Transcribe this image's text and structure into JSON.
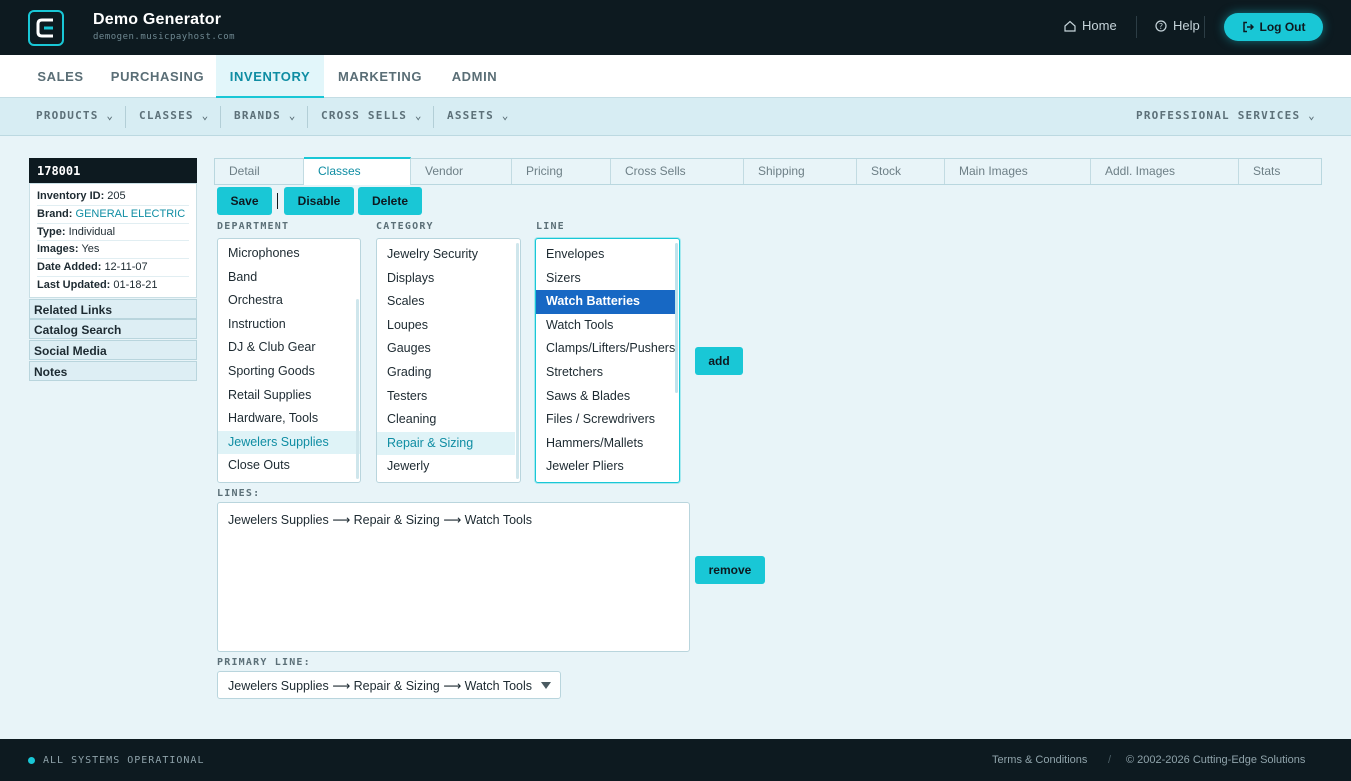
{
  "header": {
    "app_title": "Demo Generator",
    "app_subtitle": "demogen.musicpayhost.com",
    "home_label": "Home",
    "help_label": "Help",
    "logout_label": "Log Out"
  },
  "main_nav": [
    "SALES",
    "PURCHASING",
    "INVENTORY",
    "MARKETING",
    "ADMIN"
  ],
  "main_nav_active": "INVENTORY",
  "sub_nav": [
    "PRODUCTS",
    "CLASSES",
    "BRANDS",
    "CROSS SELLS",
    "ASSETS"
  ],
  "sub_nav_right": "PROFESSIONAL SERVICES",
  "product": {
    "sku": "178001",
    "inventory_id_label": "Inventory ID:",
    "inventory_id": "205",
    "brand_label": "Brand:",
    "brand": "GENERAL ELECTRIC",
    "type_label": "Type:",
    "type": "Individual",
    "images_label": "Images:",
    "images": "Yes",
    "date_added_label": "Date Added:",
    "date_added": "12-11-07",
    "last_updated_label": "Last Updated:",
    "last_updated": "01-18-21"
  },
  "side_links": [
    "Related Links",
    "Catalog Search",
    "Social Media",
    "Notes"
  ],
  "tabs": [
    "Detail",
    "Classes",
    "Vendor",
    "Pricing",
    "Cross Sells",
    "Shipping",
    "Stock",
    "Main Images",
    "Addl. Images",
    "Stats"
  ],
  "active_tab": "Classes",
  "actions": {
    "save": "Save",
    "disable": "Disable",
    "delete": "Delete",
    "add": "add",
    "remove": "remove"
  },
  "labels": {
    "department": "DEPARTMENT",
    "category": "CATEGORY",
    "line": "LINE",
    "lines": "LINES:",
    "primary_line": "PRIMARY LINE:"
  },
  "departments": [
    "Microphones",
    "Band",
    "Orchestra",
    "Instruction",
    "DJ & Club Gear",
    "Sporting Goods",
    "Retail Supplies",
    "Hardware, Tools",
    "Jewelers Supplies",
    "Close Outs"
  ],
  "department_selected": "Jewelers Supplies",
  "categories": [
    "Jewelry Security",
    "Displays",
    "Scales",
    "Loupes",
    "Gauges",
    "Grading",
    "Testers",
    "Cleaning",
    "Repair & Sizing",
    "Jewerly"
  ],
  "category_selected": "Repair & Sizing",
  "lines_list": [
    "Envelopes",
    "Sizers",
    "Watch Batteries",
    "Watch Tools",
    "Clamps/Lifters/Pushers",
    "Stretchers",
    "Saws & Blades",
    "Files / Screwdrivers",
    "Hammers/Mallets",
    "Jeweler Pliers"
  ],
  "line_selected": "Watch Batteries",
  "assigned_lines": [
    "Jewelers Supplies ⟶ Repair & Sizing ⟶ Watch Tools"
  ],
  "primary_line_value": "Jewelers Supplies ⟶ Repair & Sizing ⟶ Watch Tools",
  "footer": {
    "status": "ALL SYSTEMS OPERATIONAL",
    "terms": "Terms & Conditions",
    "copyright": "© 2002-2026 Cutting-Edge Solutions"
  },
  "colors": {
    "accent": "#19c7d6",
    "dark": "#0d1a20",
    "selected": "#1768c4",
    "link": "#0f8da3"
  }
}
